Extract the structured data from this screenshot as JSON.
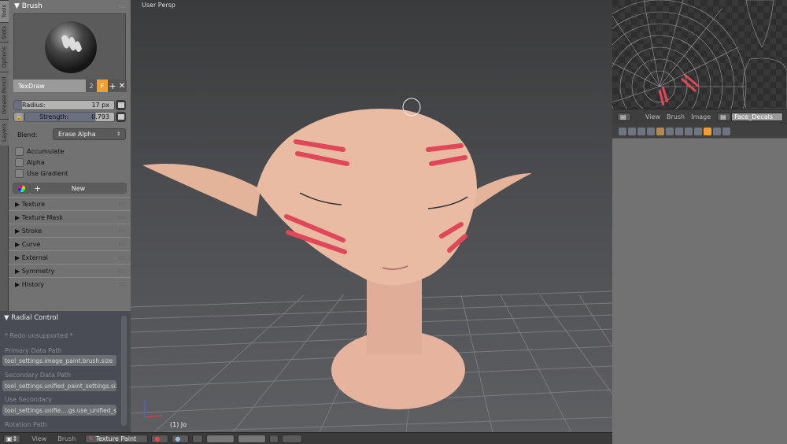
{
  "tool_tabs": [
    "Tools",
    "Slots",
    "Options",
    "Grease Pencil",
    "Layers"
  ],
  "brush_panel": {
    "title": "Brush",
    "brush_name": "TexDraw",
    "users": "2",
    "fake_user": "F",
    "radius_label": "Radius:",
    "radius_value": "17 px",
    "strength_label": "Strength:",
    "strength_value": "0.793",
    "strength_fraction": 0.793,
    "blend_label": "Blend:",
    "blend_value": "Erase Alpha",
    "checkboxes": [
      {
        "label": "Accumulate",
        "checked": false
      },
      {
        "label": "Alpha",
        "checked": false
      },
      {
        "label": "Use Gradient",
        "checked": false
      }
    ],
    "new_label": "New",
    "subpanels": [
      "Texture",
      "Texture Mask",
      "Stroke",
      "Curve",
      "External",
      "Symmetry",
      "History"
    ]
  },
  "radial_control": {
    "title": "Radial Control",
    "notice": "* Redo unsupported *",
    "fields": [
      {
        "label": "Primary Data Path",
        "value": "tool_settings.image_paint.brush.size"
      },
      {
        "label": "Secondary Data Path",
        "value": "tool_settings.unified_paint_settings.size"
      },
      {
        "label": "Use Secondary",
        "value": "tool_settings.unifie....gs.use_unified_size"
      },
      {
        "label": "Rotation Path",
        "value": ""
      }
    ]
  },
  "viewport": {
    "label": "User Persp",
    "object_label": "(1) Jo"
  },
  "bottom_bar": {
    "view": "View",
    "brush": "Brush",
    "mode": "Texture Paint"
  },
  "image_editor": {
    "view": "View",
    "brush": "Brush",
    "image": "Image",
    "image_name": "Face_Decals"
  },
  "colors": {
    "accent": "#f0a030",
    "paint": "#e0485a"
  }
}
